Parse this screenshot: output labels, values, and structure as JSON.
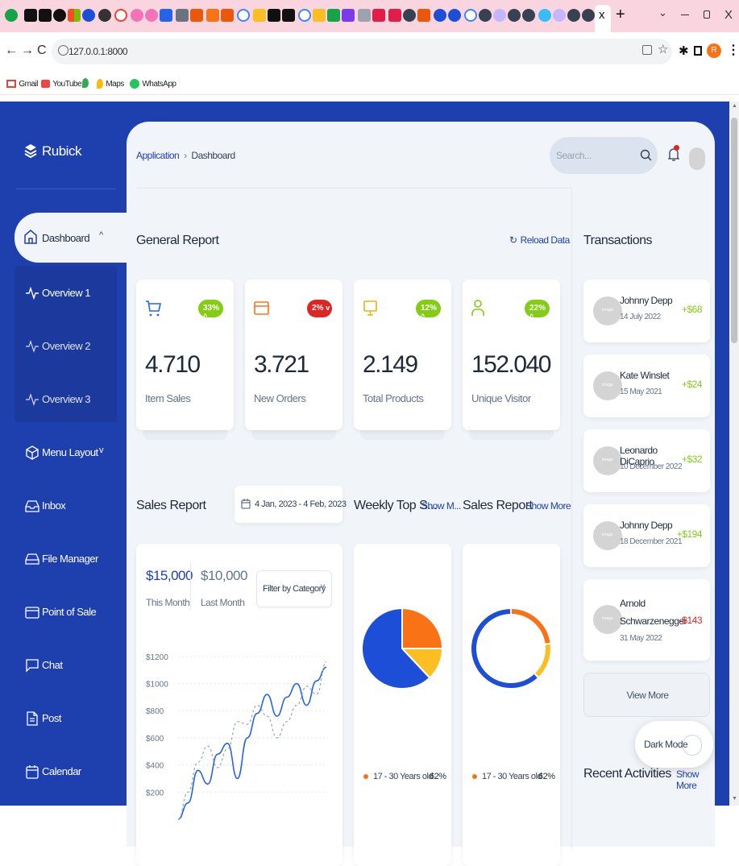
{
  "browser": {
    "close_tab": "x",
    "new_tab": "+",
    "url": "127.0.0.1:8000",
    "profile_initial": "R",
    "bookmarks": [
      "Gmail",
      "YouTube",
      "Maps",
      "WhatsApp"
    ]
  },
  "brand": {
    "name": "Rubick"
  },
  "sidebar": {
    "items": [
      {
        "label": "Dashboard",
        "icon": "home-icon"
      },
      {
        "label": "Overview 1",
        "icon": "activity-icon"
      },
      {
        "label": "Overview 2",
        "icon": "activity-icon"
      },
      {
        "label": "Overview 3",
        "icon": "activity-icon"
      },
      {
        "label": "Menu Layout",
        "icon": "box-icon"
      },
      {
        "label": "Inbox",
        "icon": "inbox-icon"
      },
      {
        "label": "File Manager",
        "icon": "hard-drive-icon"
      },
      {
        "label": "Point of Sale",
        "icon": "credit-card-icon"
      },
      {
        "label": "Chat",
        "icon": "message-square-icon"
      },
      {
        "label": "Post",
        "icon": "file-text-icon"
      },
      {
        "label": "Calendar",
        "icon": "calendar-icon"
      }
    ]
  },
  "header": {
    "breadcrumb": [
      "Application",
      "Dashboard"
    ],
    "search_placeholder": "Search..."
  },
  "general_report": {
    "title": "General Report",
    "reload_label": "Reload Data",
    "stats": [
      {
        "value": "4.710",
        "label": "Item Sales",
        "badge": "33%",
        "trend": "up",
        "badge_color": "#84cc16",
        "icon": "shopping-cart-icon",
        "icon_color": "#2563eb"
      },
      {
        "value": "3.721",
        "label": "New Orders",
        "badge": "2%",
        "trend": "down",
        "badge_color": "#dc2626",
        "icon": "credit-card-icon",
        "icon_color": "#f97316"
      },
      {
        "value": "2.149",
        "label": "Total Products",
        "badge": "12%",
        "trend": "up",
        "badge_color": "#84cc16",
        "icon": "monitor-icon",
        "icon_color": "#eab308"
      },
      {
        "value": "152.040",
        "label": "Unique Visitor",
        "badge": "22%",
        "trend": "up",
        "badge_color": "#84cc16",
        "icon": "user-icon",
        "icon_color": "#84cc16"
      }
    ]
  },
  "sales_report": {
    "title": "Sales Report",
    "date_range": "4 Jan, 2023 - 4 Feb, 2023",
    "this_month_value": "$15,000",
    "this_month_label": "This Month",
    "last_month_value": "$10,000",
    "last_month_label": "Last Month",
    "filter_label": "Filter by Category"
  },
  "weekly_top": {
    "title": "Weekly Top S...",
    "show_more": "Show M...",
    "legend_label": "17 - 30 Years old",
    "legend_value": "62%"
  },
  "sales_report_2": {
    "title": "Sales Report",
    "show_more": "Show More",
    "legend_label": "17 - 30 Years old",
    "legend_value": "62%"
  },
  "transactions": {
    "title": "Transactions",
    "items": [
      {
        "name": "Johnny Depp",
        "date": "14 July 2022",
        "amount": "+$68",
        "positive": true
      },
      {
        "name": "Kate Winslet",
        "date": "15 May 2021",
        "amount": "+$24",
        "positive": true
      },
      {
        "name": "Leonardo DiCaprio",
        "date": "10 December 2022",
        "amount": "+$32",
        "positive": true
      },
      {
        "name": "Johnny Depp",
        "date": "18 December 2021",
        "amount": "+$194",
        "positive": true
      },
      {
        "name": "Arnold Schwarzenegger",
        "date": "31 May 2022",
        "amount": "-$143",
        "positive": false
      }
    ],
    "view_more": "View More",
    "avatar_text": "image"
  },
  "recent_activities": {
    "title": "Recent Activities",
    "show_more": "Show More"
  },
  "dark_mode": {
    "label": "Dark Mode"
  },
  "chart_data": [
    {
      "type": "line",
      "title": "",
      "yticks": [
        "$1200",
        "$1000",
        "$800",
        "$600",
        "$400",
        "$200"
      ],
      "ylim": [
        0,
        1300
      ],
      "series": [
        {
          "values": [
            0,
            120,
            360,
            260,
            480,
            560,
            300,
            600,
            780,
            920,
            760,
            900,
            1000,
            840,
            1020,
            1120
          ],
          "style": "solid",
          "color": "#2563eb"
        },
        {
          "values": [
            0,
            200,
            420,
            540,
            380,
            520,
            720,
            700,
            840,
            760,
            600,
            720,
            840,
            980,
            920,
            1160
          ],
          "style": "dashed",
          "color": "#94a3b8"
        }
      ]
    },
    {
      "type": "pie",
      "slices": [
        {
          "label": "17 - 30 Years old",
          "value": 62,
          "color": "#1d4ed8"
        },
        {
          "label": "",
          "value": 13,
          "color": "#fbbf24"
        },
        {
          "label": "",
          "value": 25,
          "color": "#f97316"
        }
      ]
    },
    {
      "type": "pie",
      "style": "donut",
      "slices": [
        {
          "label": "17 - 30 Years old",
          "value": 62,
          "color": "#1d4ed8"
        },
        {
          "label": "",
          "value": 15,
          "color": "#fbbf24"
        },
        {
          "label": "",
          "value": 23,
          "color": "#f97316"
        }
      ]
    }
  ]
}
